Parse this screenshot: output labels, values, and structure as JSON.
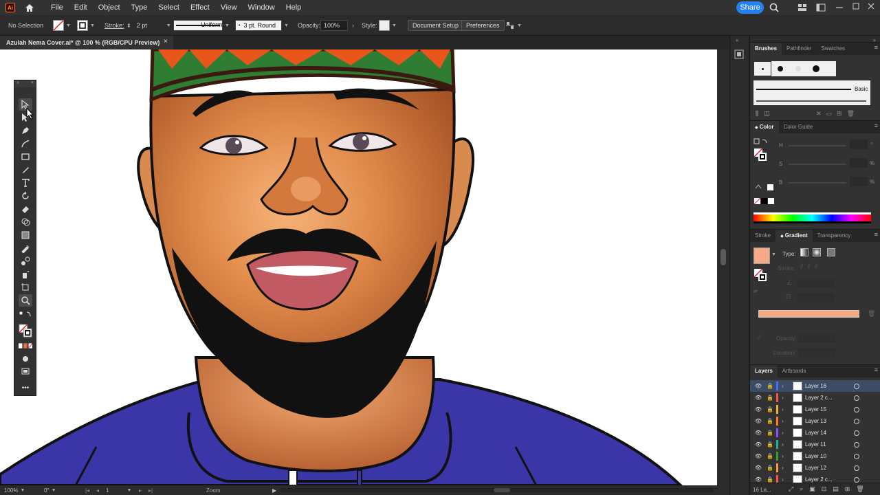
{
  "menu": {
    "app_logo": "Ai",
    "items": [
      "File",
      "Edit",
      "Object",
      "Type",
      "Select",
      "Effect",
      "View",
      "Window",
      "Help"
    ],
    "share_label": "Share"
  },
  "control_bar": {
    "selection_label": "No Selection",
    "stroke_label": "Stroke:",
    "stroke_weight": "2 pt",
    "profile": "Uniform",
    "brush": "3 pt. Round",
    "opacity_label": "Opacity:",
    "opacity_value": "100%",
    "style_label": "Style:",
    "document_setup": "Document Setup",
    "preferences": "Preferences"
  },
  "document": {
    "tab_title": "Azulah Nema Cover.ai* @ 100 % (RGB/CPU Preview)",
    "close": "×"
  },
  "status_bar": {
    "zoom": "100%",
    "rotation": "0°",
    "artboard": "1",
    "tool": "Zoom"
  },
  "brushes_panel": {
    "tabs": [
      "Brushes",
      "Pathfinder",
      "Swatches"
    ],
    "basic_label": "Basic"
  },
  "color_panel": {
    "tabs": [
      "Color",
      "Color Guide"
    ],
    "h_label": "H",
    "s_label": "S",
    "b_label": "B",
    "h_unit": "°",
    "s_unit": "%",
    "b_unit": "%"
  },
  "gradient_panel": {
    "tabs": [
      "Stroke",
      "Gradient",
      "Transparency"
    ],
    "type_label": "Type:",
    "stroke_label": "Stroke:",
    "opacity_label": "Opacity:",
    "location_label": "Location:",
    "swatch_color": "#f5a985"
  },
  "layers_panel": {
    "tabs": [
      "Layers",
      "Artboards"
    ],
    "footer_count": "16 La...",
    "layers": [
      {
        "name": "Layer 16",
        "color": "#4f6bff",
        "selected": true
      },
      {
        "name": "Layer 2 c...",
        "color": "#ff4f4f",
        "selected": false
      },
      {
        "name": "Layer 15",
        "color": "#f0b030",
        "selected": false
      },
      {
        "name": "Layer 13",
        "color": "#ff7a20",
        "selected": false
      },
      {
        "name": "Layer 14",
        "color": "#8a4fff",
        "selected": false
      },
      {
        "name": "Layer 11",
        "color": "#20b0a0",
        "selected": false
      },
      {
        "name": "Layer 10",
        "color": "#30a030",
        "selected": false
      },
      {
        "name": "Layer 12",
        "color": "#ff9a40",
        "selected": false
      },
      {
        "name": "Layer 2 c...",
        "color": "#ff4f4f",
        "selected": false
      }
    ]
  },
  "colors": {
    "accent": "#2680eb",
    "shirt": "#3a35a8",
    "skin": "#d98a4e",
    "beard": "#111111"
  }
}
